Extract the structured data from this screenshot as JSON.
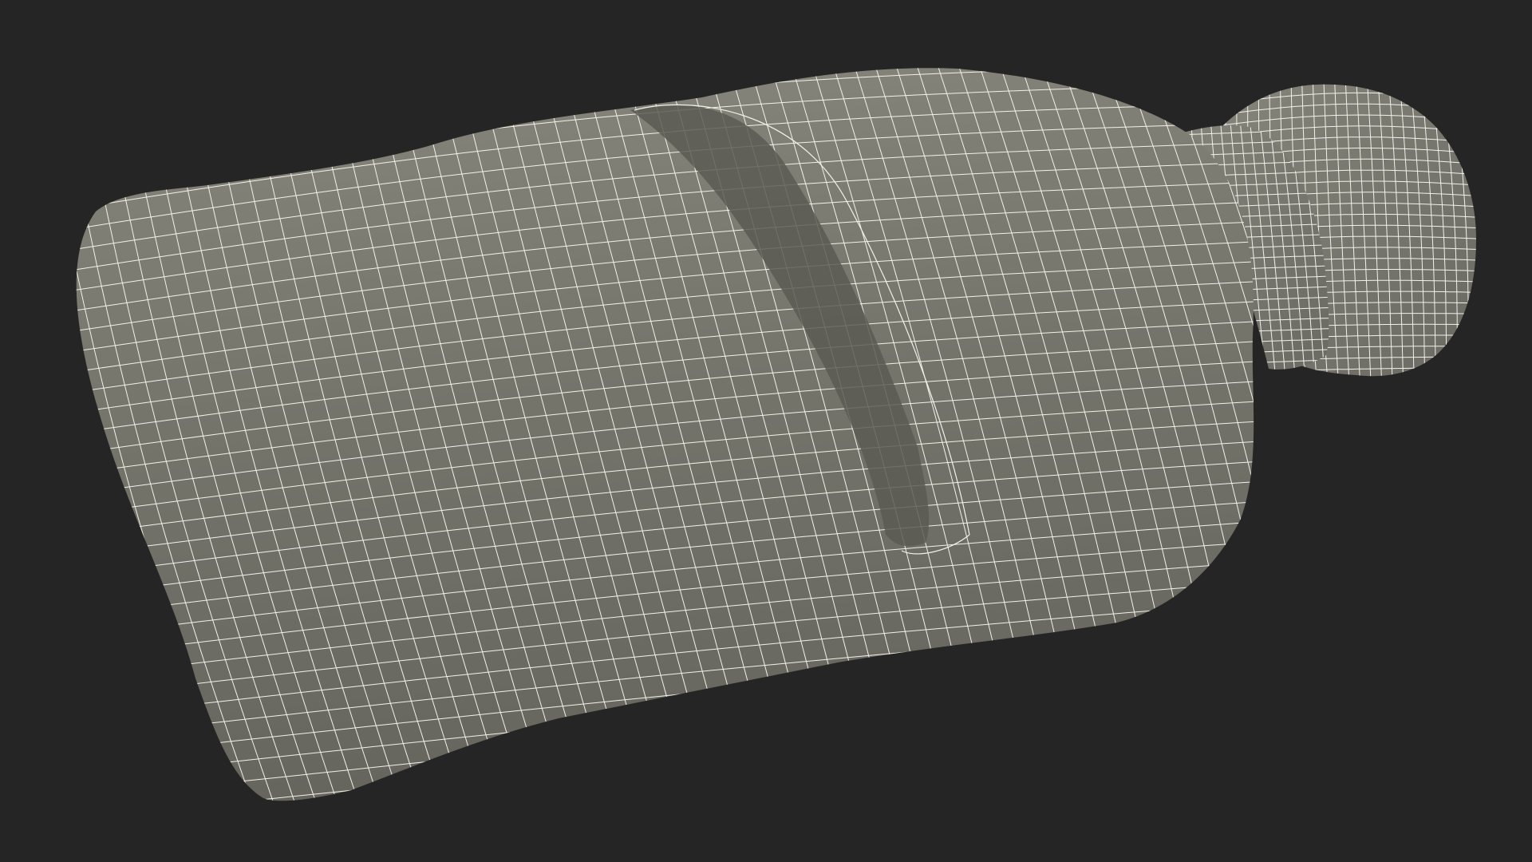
{
  "scene": {
    "subject_icon": "bottle-wireframe-icon",
    "colors": {
      "background": "#252525",
      "surface": "#74746b",
      "surface_dark": "#5e5e57",
      "surface_light": "#86867c",
      "wire": "#f2f2ea"
    }
  }
}
